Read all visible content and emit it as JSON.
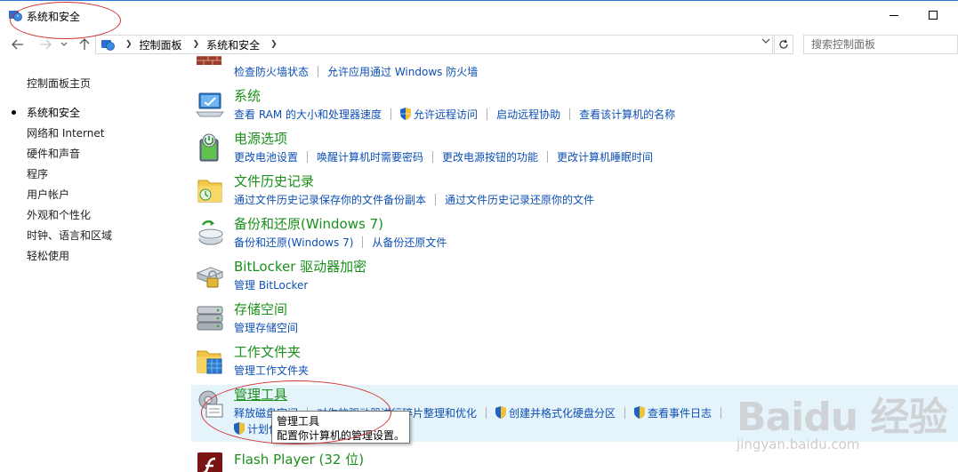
{
  "window": {
    "title": "系统和安全"
  },
  "toolbar": {
    "crumbs": [
      "控制面板",
      "系统和安全"
    ],
    "search_placeholder": "搜索控制面板"
  },
  "sidebar": {
    "home": "控制面板主页",
    "items": [
      "系统和安全",
      "网络和 Internet",
      "硬件和声音",
      "程序",
      "用户帐户",
      "外观和个性化",
      "时钟、语言和区域",
      "轻松使用"
    ],
    "active_index": 0
  },
  "categories": [
    {
      "title": "",
      "icon": "firewall-icon",
      "links": [
        {
          "text": "检查防火墙状态",
          "shield": false
        },
        {
          "text": "允许应用通过 Windows 防火墙",
          "shield": false
        }
      ]
    },
    {
      "title": "系统",
      "icon": "system-monitor-icon",
      "links": [
        {
          "text": "查看 RAM 的大小和处理器速度",
          "shield": false
        },
        {
          "text": "允许远程访问",
          "shield": true
        },
        {
          "text": "启动远程协助",
          "shield": false
        },
        {
          "text": "查看该计算机的名称",
          "shield": false
        }
      ]
    },
    {
      "title": "电源选项",
      "icon": "power-battery-icon",
      "links": [
        {
          "text": "更改电池设置",
          "shield": false
        },
        {
          "text": "唤醒计算机时需要密码",
          "shield": false
        },
        {
          "text": "更改电源按钮的功能",
          "shield": false
        },
        {
          "text": "更改计算机睡眠时间",
          "shield": false
        }
      ]
    },
    {
      "title": "文件历史记录",
      "icon": "file-history-icon",
      "links": [
        {
          "text": "通过文件历史记录保存你的文件备份副本",
          "shield": false
        },
        {
          "text": "通过文件历史记录还原你的文件",
          "shield": false
        }
      ]
    },
    {
      "title": "备份和还原(Windows 7)",
      "icon": "backup-restore-icon",
      "links": [
        {
          "text": "备份和还原(Windows 7)",
          "shield": false
        },
        {
          "text": "从备份还原文件",
          "shield": false
        }
      ]
    },
    {
      "title": "BitLocker 驱动器加密",
      "icon": "bitlocker-icon",
      "links": [
        {
          "text": "管理 BitLocker",
          "shield": false
        }
      ]
    },
    {
      "title": "存储空间",
      "icon": "storage-spaces-icon",
      "links": [
        {
          "text": "管理存储空间",
          "shield": false
        }
      ]
    },
    {
      "title": "工作文件夹",
      "icon": "work-folders-icon",
      "links": [
        {
          "text": "管理工作文件夹",
          "shield": false
        }
      ]
    },
    {
      "title": "管理工具",
      "icon": "admin-tools-icon",
      "links": [
        {
          "text": "释放磁盘空间",
          "shield": false
        },
        {
          "text": "对你的驱动器进行碎片整理和优化",
          "shield": false
        },
        {
          "text": "创建并格式化硬盘分区",
          "shield": true
        },
        {
          "text": "查看事件日志",
          "shield": true
        },
        {
          "text": "计划任务",
          "shield": true
        }
      ]
    },
    {
      "title": "Flash Player (32 位)",
      "icon": "flash-player-icon",
      "links": []
    }
  ],
  "tooltip": {
    "line1": "管理工具",
    "line2": "配置你计算机的管理设置。"
  },
  "watermark": {
    "brand": "Baidu 经验",
    "url": "jingyan.baidu.com"
  },
  "colors": {
    "category_title": "#1a8f1a",
    "link": "#0d4fb3",
    "hover_row": "#e5f3fb",
    "annotation": "#d23131"
  }
}
